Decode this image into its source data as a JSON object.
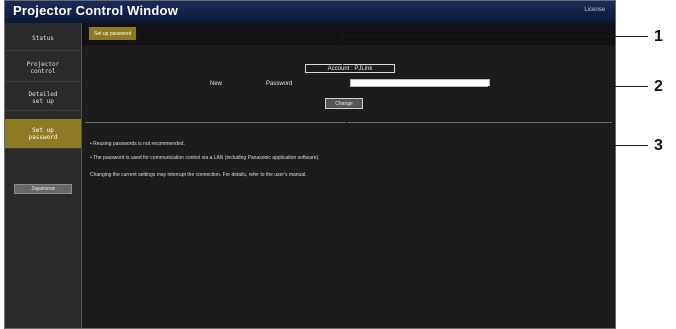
{
  "header": {
    "title": "Projector Control Window",
    "license_link": "License"
  },
  "sidebar": {
    "items": [
      {
        "label": "Status",
        "active": false
      },
      {
        "label": "Projector\ncontrol",
        "active": false
      },
      {
        "label": "Detailed\nset up",
        "active": false
      },
      {
        "label": "Set up\npassword",
        "active": true
      }
    ],
    "language_button": "Japanese"
  },
  "main": {
    "tab_label": "Set up password",
    "account_label": "Account",
    "account_separator": ":",
    "account_value": "PJLink",
    "new_label": "New",
    "password_label": "Password",
    "password_value": "",
    "change_button": "Change",
    "notes": [
      "• Reusing passwords is not recommended.",
      "• The password is used for communication control via a LAN (including Panasonic application software).",
      "Changing the current settings may interrupt the connection. For details, refer to the user's manual."
    ]
  },
  "callouts": [
    "1",
    "2",
    "3"
  ],
  "colors": {
    "accent": "#8e7a22",
    "header": "#1a2b5a",
    "panel": "#1c1c1c"
  }
}
